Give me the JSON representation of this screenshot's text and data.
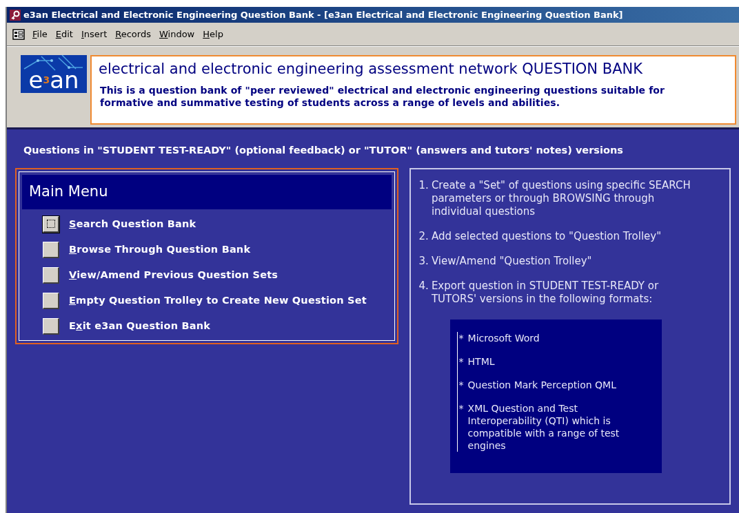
{
  "window": {
    "title": "e3an Electrical and Electronic Engineering Question Bank - [e3an Electrical and Electronic Engineering Question Bank]"
  },
  "menu_bar": [
    {
      "key": "F",
      "rest": "ile"
    },
    {
      "key": "E",
      "rest": "dit"
    },
    {
      "key": "I",
      "rest": "nsert"
    },
    {
      "key": "R",
      "rest": "ecords"
    },
    {
      "key": "W",
      "rest": "indow"
    },
    {
      "key": "H",
      "rest": "elp"
    }
  ],
  "header": {
    "logo": {
      "base": "e",
      "sup": "3",
      "rest": "an"
    },
    "title": "electrical and electronic engineering assessment network QUESTION BANK",
    "description": "This is a question bank of \"peer reviewed\" electrical and electronic engineering questions suitable for formative and summative testing of students across a range of levels and abilities."
  },
  "subtitle": "Questions in \"STUDENT TEST-READY\" (optional feedback) or \"TUTOR\" (answers and tutors' notes) versions",
  "main_menu": {
    "title": "Main Menu",
    "items": [
      {
        "key": "S",
        "after": "earch Question Bank",
        "selected": true
      },
      {
        "key": "B",
        "after": "rowse Through Question Bank",
        "selected": false
      },
      {
        "key": "V",
        "after": "iew/Amend Previous Question Sets",
        "selected": false
      },
      {
        "key": "E",
        "after": "mpty Question Trolley to Create New Question Set",
        "selected": false
      },
      {
        "before": "E",
        "key": "x",
        "after": "it e3an Question Bank",
        "selected": false
      }
    ]
  },
  "steps": [
    {
      "number": "1.",
      "text": "Create a \"Set\" of questions using specific SEARCH parameters or through BROWSING through individual questions"
    },
    {
      "number": "2.",
      "text": "Add selected questions to \"Question Trolley\""
    },
    {
      "number": "3.",
      "text": "View/Amend \"Question Trolley\""
    },
    {
      "number": "4.",
      "text": "Export question in STUDENT TEST-READY or TUTORS' versions in the following formats:"
    }
  ],
  "formats": [
    {
      "bullet": "*",
      "text": "Microsoft Word"
    },
    {
      "bullet": "*",
      "text": "HTML"
    },
    {
      "bullet": "*",
      "text": "Question Mark Perception QML"
    },
    {
      "bullet": "*",
      "text": "XML Question and Test Interoperability (QTI) which is compatible with a range of test engines"
    }
  ]
}
